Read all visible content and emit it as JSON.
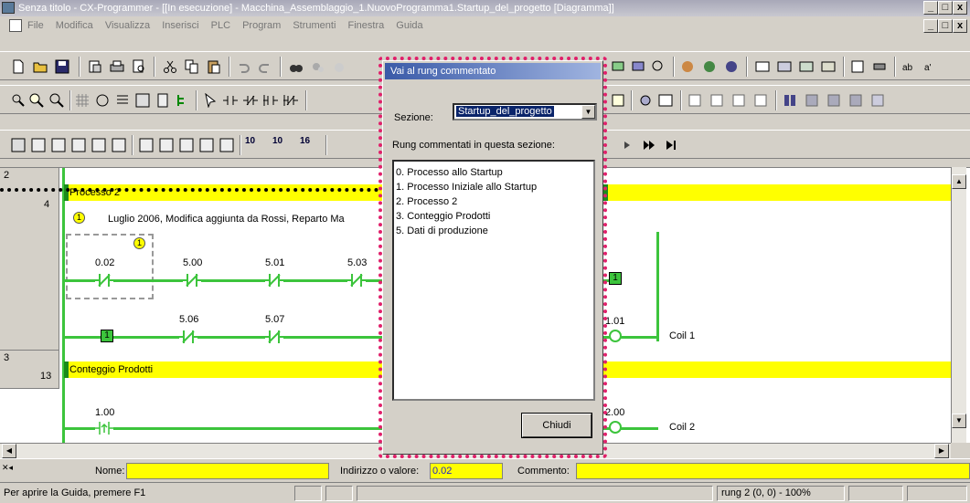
{
  "window": {
    "title": "Senza titolo - CX-Programmer - [[In esecuzione] - Macchina_Assemblaggio_1.NuovoProgramma1.Startup_del_progetto [Diagramma]]",
    "btn_minimize": "_",
    "btn_restore": "□",
    "btn_close": "x"
  },
  "menu": [
    "File",
    "Modifica",
    "Visualizza",
    "Inserisci",
    "PLC",
    "Program",
    "Strumenti",
    "Finestra",
    "Guida"
  ],
  "ladder": {
    "rung2": {
      "number": "2",
      "step": "4",
      "comment": "Processo 2",
      "annotation_num": "1",
      "annotation_text": "Luglio 2006, Modifica aggiunta da Rossi, Reparto Ma",
      "contacts_row1": [
        "0.02",
        "5.00",
        "5.01",
        "5.03"
      ],
      "contacts_row2": [
        "5.06",
        "5.07"
      ],
      "box_label": "1",
      "output_box": "1",
      "coil_addr": "1.01",
      "coil_name": "Coil 1"
    },
    "rung3": {
      "number": "3",
      "step": "13",
      "comment": "Conteggio Prodotti",
      "contact": "1.00",
      "coil_addr": "2.00",
      "coil_name": "Coil 2"
    }
  },
  "dialog": {
    "title": "Vai al rung commentato",
    "section_label": "Sezione:",
    "section_value": "Startup_del_progetto",
    "list_label": "Rung commentati in questa sezione:",
    "items": [
      "0. Processo allo Startup",
      "1. Processo Iniziale allo Startup",
      "2. Processo 2",
      "3. Conteggio Prodotti",
      "5. Dati di produzione"
    ],
    "close_button": "Chiudi"
  },
  "properties": {
    "name_label": "Nome:",
    "name_value": "",
    "address_label": "Indirizzo o valore:",
    "address_value": "0.02",
    "comment_label": "Commento:",
    "comment_value": ""
  },
  "status": {
    "help_text": "Per aprire la Guida, premere F1",
    "position": "rung 2 (0, 0)  - 100%"
  },
  "toolbar3_numbers": [
    "10",
    "10",
    "16"
  ]
}
